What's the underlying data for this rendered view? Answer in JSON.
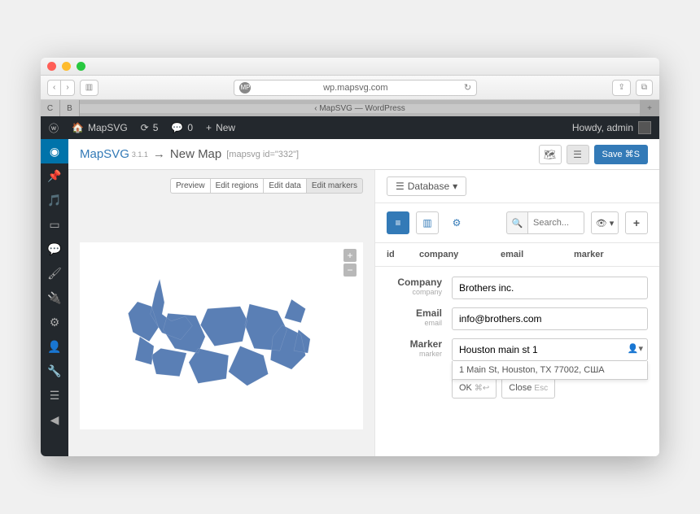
{
  "browser": {
    "url": "wp.mapsvg.com",
    "tab_title": "‹ MapSVG — WordPress"
  },
  "adminbar": {
    "site": "MapSVG",
    "updates": "5",
    "comments": "0",
    "new": "New",
    "howdy": "Howdy, admin"
  },
  "header": {
    "brand": "MapSVG",
    "version": "3.1.1",
    "arrow": "→",
    "title": "New Map",
    "map_id": "[mapsvg id=\"332\"]",
    "save": "Save ⌘S"
  },
  "edit_buttons": [
    "Preview",
    "Edit regions",
    "Edit data",
    "Edit markers"
  ],
  "database": {
    "tab": "Database",
    "search_placeholder": "Search...",
    "columns": [
      "id",
      "company",
      "email",
      "marker"
    ]
  },
  "form": {
    "company": {
      "label": "Company",
      "sub": "company",
      "value": "Brothers inc."
    },
    "email": {
      "label": "Email",
      "sub": "email",
      "value": "info@brothers.com"
    },
    "marker": {
      "label": "Marker",
      "sub": "marker",
      "value": "Houston main st 1",
      "suggestion": "1 Main St, Houston, TX 77002, США"
    },
    "ok": "OK",
    "ok_kbd": "⌘↩",
    "close": "Close",
    "close_kbd": "Esc"
  }
}
